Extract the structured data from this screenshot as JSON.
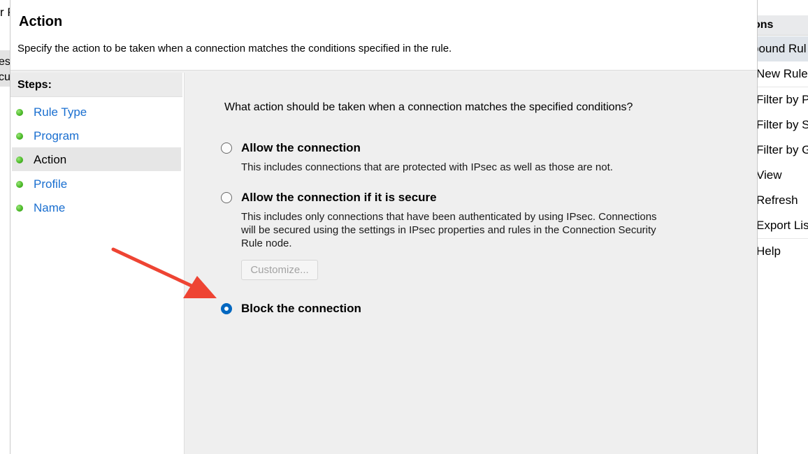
{
  "background": {
    "left_title_fragment": "r F",
    "left_row1": "es",
    "left_row2": "cu"
  },
  "actions_pane": {
    "header": "ons",
    "section": "bound Rul",
    "items": [
      "New Rule",
      "Filter by P",
      "Filter by S",
      "Filter by G",
      "View",
      "Refresh",
      "Export Lis",
      "Help"
    ]
  },
  "dialog": {
    "title": "Action",
    "description": "Specify the action to be taken when a connection matches the conditions specified in the rule."
  },
  "steps": {
    "heading": "Steps:",
    "items": [
      {
        "label": "Rule Type",
        "current": false
      },
      {
        "label": "Program",
        "current": false
      },
      {
        "label": "Action",
        "current": true
      },
      {
        "label": "Profile",
        "current": false
      },
      {
        "label": "Name",
        "current": false
      }
    ]
  },
  "content": {
    "question": "What action should be taken when a connection matches the specified conditions?",
    "options": [
      {
        "label": "Allow the connection",
        "description": [
          "This includes connections that are protected with IPsec as well as those are not."
        ],
        "selected": false
      },
      {
        "label": "Allow the connection if it is secure",
        "description": [
          "This includes only connections that have been authenticated by using IPsec.  Connections",
          "will be secured using the settings in IPsec properties and rules in the Connection Security",
          "Rule node."
        ],
        "selected": false
      },
      {
        "label": "Block the connection",
        "description": [],
        "selected": true
      }
    ],
    "customize_button": "Customize..."
  },
  "colors": {
    "accent": "#0067c0",
    "step_link": "#1a6fd0",
    "annotation_arrow": "#ee4433"
  },
  "icons": [
    "green-dot-icon",
    "red-arrow-icon"
  ]
}
